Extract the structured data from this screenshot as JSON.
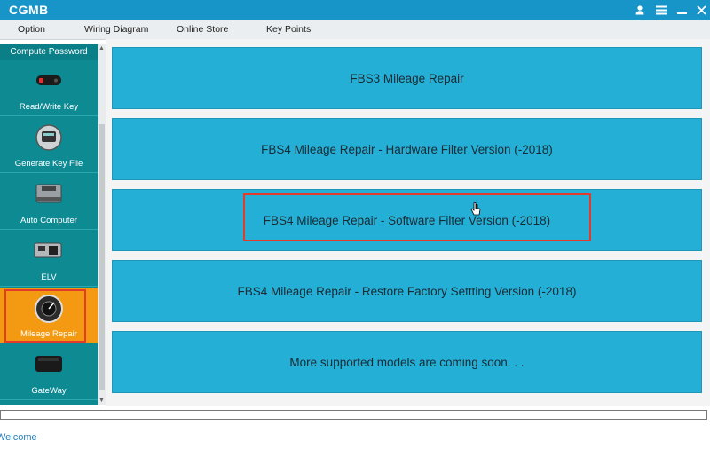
{
  "app": {
    "title": "CGMB"
  },
  "window_controls": {
    "user_icon": "user-icon",
    "menu_icon": "hamburger-icon",
    "minimize_icon": "minimize-icon",
    "close_icon": "close-icon"
  },
  "menu": [
    "Option",
    "Wiring Diagram",
    "Online Store",
    "Key Points"
  ],
  "sidebar": {
    "header": "Compute Password",
    "items": [
      {
        "label": "Read/Write Key",
        "icon": "car-key-icon"
      },
      {
        "label": "Generate Key File",
        "icon": "key-programmer-icon"
      },
      {
        "label": "Auto Computer",
        "icon": "ecu-module-icon"
      },
      {
        "label": "ELV",
        "icon": "elv-module-icon"
      },
      {
        "label": "Mileage Repair",
        "icon": "odometer-icon",
        "active": true
      },
      {
        "label": "GateWay",
        "icon": "gateway-module-icon"
      }
    ]
  },
  "options": [
    "FBS3 Mileage Repair",
    "FBS4 Mileage Repair - Hardware Filter Version (-2018)",
    "FBS4 Mileage Repair - Software Filter Version (-2018)",
    "FBS4 Mileage Repair - Restore Factory Settting Version (-2018)",
    "More supported models are coming soon. . ."
  ],
  "status": {
    "text": "Welcome"
  },
  "colors": {
    "titlebar": "#1794c8",
    "sidebar": "#0e8a93",
    "active": "#f39a12",
    "option": "#24afd6",
    "highlight": "#e23b2c"
  }
}
